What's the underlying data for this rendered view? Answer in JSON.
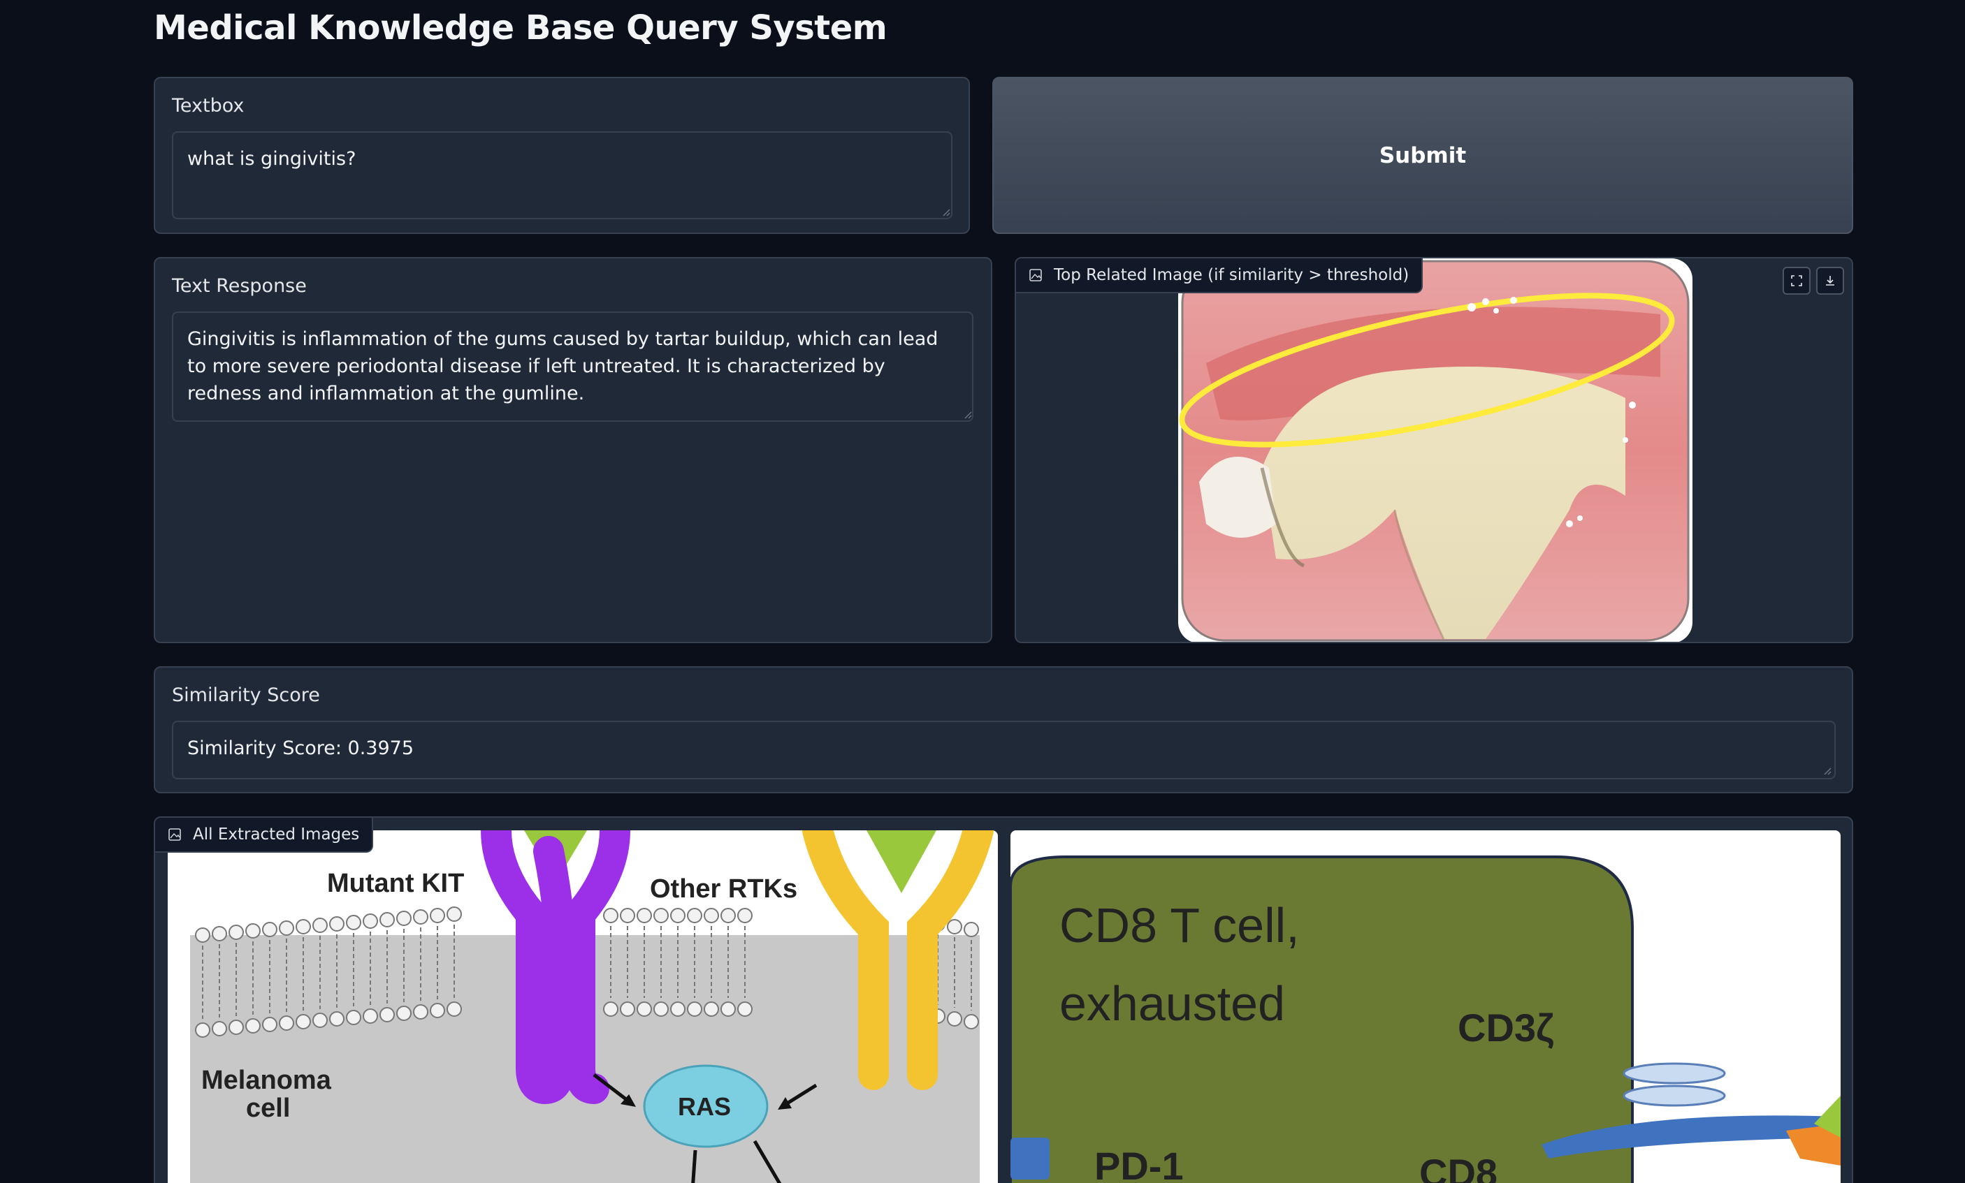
{
  "app": {
    "title": "Medical Knowledge Base Query System"
  },
  "query": {
    "label": "Textbox",
    "value": "what is gingivitis?"
  },
  "submit": {
    "label": "Submit"
  },
  "response": {
    "label": "Text Response",
    "value": "Gingivitis is inflammation of the gums caused by tartar buildup, which can lead to more severe periodontal disease if left untreated. It is characterized by redness and inflammation at the gumline."
  },
  "top_image": {
    "label": "Top Related Image (if similarity > threshold)",
    "icons": [
      "fullscreen-icon",
      "download-icon"
    ]
  },
  "similarity": {
    "label": "Similarity Score",
    "value": "Similarity Score: 0.3975"
  },
  "gallery": {
    "label": "All Extracted Images",
    "image1": {
      "labels": {
        "mutant_kit": "Mutant KIT",
        "other_rtks": "Other RTKs",
        "melanoma_1": "Melanoma",
        "melanoma_2": "cell",
        "ras": "RAS"
      }
    },
    "image2": {
      "labels": {
        "cd8_line1": "CD8 T cell,",
        "cd8_line2": "exhausted",
        "cd3z": "CD3ζ",
        "pd1": "PD-1",
        "cd8": "CD8"
      }
    }
  },
  "colors": {
    "background": "#0b0f19",
    "panel": "#1f2937",
    "border": "#374151",
    "button": "#4b5563"
  }
}
